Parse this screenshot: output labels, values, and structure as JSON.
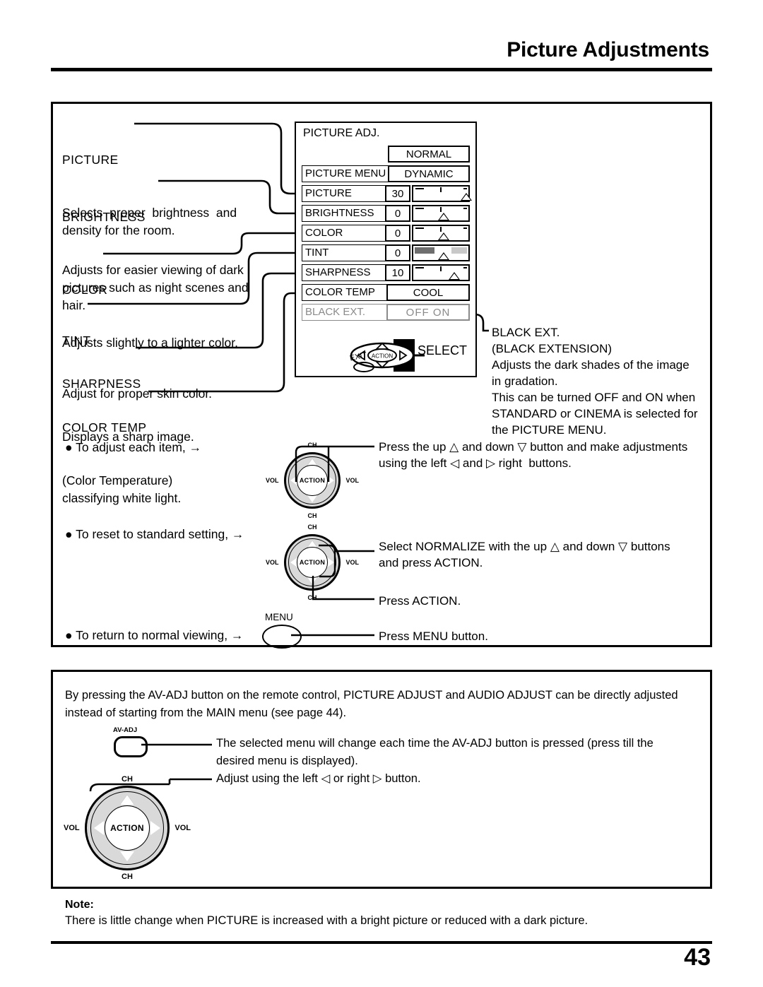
{
  "header": {
    "title": "Picture Adjustments"
  },
  "descriptions": [
    {
      "term": "PICTURE",
      "body": "Selects  proper  brightness  and\ndensity for the room."
    },
    {
      "term": "BRIGHTNESS",
      "body": "Adjusts for easier viewing of dark\npictures such as night scenes and\nhair."
    },
    {
      "term": "COLOR",
      "body": "Adjusts slightly to a lighter color."
    },
    {
      "term": "TINT",
      "body": "Adjust for proper skin color."
    },
    {
      "term": "SHARPNESS",
      "body": "Displays a sharp image."
    },
    {
      "term": "COLOR TEMP",
      "body": "(Color Temperature)\nclassifying white light."
    }
  ],
  "osd": {
    "title": "PICTURE ADJ.",
    "normalize": "NORMAL",
    "rows": [
      {
        "label": "PICTURE  MENU",
        "value": "DYNAMIC",
        "type": "option"
      },
      {
        "label": "PICTURE",
        "value": "30",
        "type": "slider",
        "thumb_pct": 93
      },
      {
        "label": "BRIGHTNESS",
        "value": "0",
        "type": "slider",
        "thumb_pct": 50
      },
      {
        "label": "COLOR",
        "value": "0",
        "type": "slider",
        "thumb_pct": 50
      },
      {
        "label": "TINT",
        "value": "0",
        "type": "slider-tint",
        "thumb_pct": 50
      },
      {
        "label": "SHARPNESS",
        "value": "10",
        "type": "slider",
        "thumb_pct": 72
      },
      {
        "label": "COLOR  TEMP",
        "value": "COOL",
        "type": "option"
      },
      {
        "label": "BLACK EXT.",
        "value": "OFF      ON",
        "type": "option",
        "disabled": true
      }
    ]
  },
  "action_cluster": {
    "action_label": "ACTION",
    "exit_label": "EXIT",
    "select_label": "SELECT"
  },
  "black_ext_note": "BLACK EXT.\n(BLACK EXTENSION)\nAdjusts the dark shades of the image\nin gradation.\nThis can be turned OFF and ON when\nSTANDARD or CINEMA is selected for\nthe PICTURE MENU.",
  "steps": [
    {
      "bullet": "● To adjust each item,  →",
      "instruction": "Press the up △ and down ▽ button and make adjustments\nusing the left ◁ and ▷ right  buttons."
    },
    {
      "bullet": "● To reset to standard setting, →",
      "instruction": "Select NORMALIZE with the up △ and down ▽ buttons\nand press ACTION.",
      "instruction2": "Press ACTION."
    },
    {
      "bullet": "● To return to  normal viewing, →",
      "instruction": "Press MENU button."
    }
  ],
  "remote": {
    "action_label": "ACTION",
    "ch_label": "CH",
    "vol_label": "VOL",
    "menu_button_label": "MENU",
    "avadj_button_label": "AV-ADJ"
  },
  "lower": {
    "intro": "By pressing the AV-ADJ button on the remote control, PICTURE ADJUST and AUDIO ADJUST can be directly adjusted\ninstead of starting from the MAIN menu (see page 44).",
    "avadj_text": "The selected menu will change each time the AV-ADJ button is pressed (press till the\ndesired menu is displayed).",
    "adjust_text": "Adjust using the left ◁ or right ▷ button."
  },
  "note": {
    "label": "Note:",
    "text": "There is little change when PICTURE is increased with a bright picture or reduced with a dark picture."
  },
  "page_number": "43",
  "colors": {
    "ink": "#000000",
    "disabled": "#8a8a8a",
    "pad_fill": "#d9d9d9",
    "tint_dark": "#6e6e6e",
    "tint_mid": "#ffffff",
    "tint_light": "#c8c8c8"
  }
}
